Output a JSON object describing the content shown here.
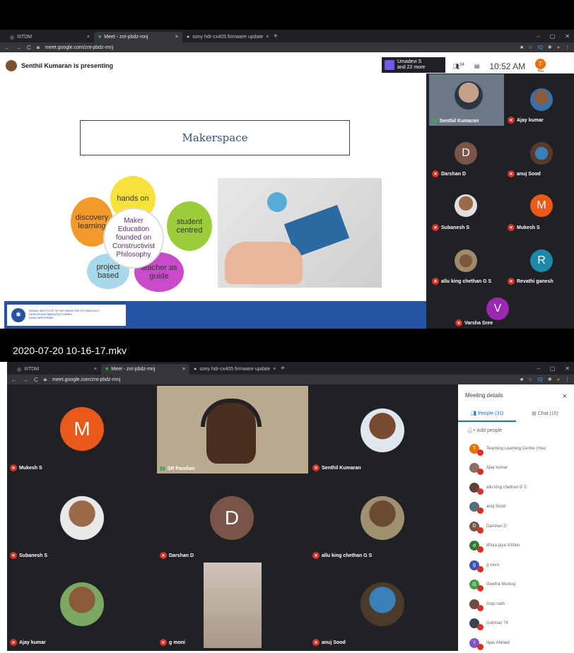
{
  "top": {
    "tabs": [
      {
        "label": "IIITDM"
      },
      {
        "label": "Meet - znt-pbdz-mnj",
        "active": true
      },
      {
        "label": "sony hdr-cx405 firmware update"
      }
    ],
    "url": "meet.google.com/znt-pbdz-mnj",
    "presenting": "Senthil Kumaran is presenting",
    "viewers": {
      "line1": "Umadevi S",
      "line2": "and 22 more"
    },
    "participants_count": "34",
    "time": "10:52 AM",
    "you_initial": "T",
    "you_label": "You",
    "slide": {
      "title": "Makerspace",
      "center_lines": [
        "Maker",
        "Education",
        "founded on",
        "Constructivist",
        "Philosophy"
      ],
      "petals": [
        "hands on",
        "student centred",
        "teacher as guide",
        "project based",
        "discovery learning"
      ],
      "institute_lines": [
        "INDIAN INSTITUTE OF INFORMATION TECHNOLOGY,",
        "DESIGN AND MANUFACTURING,",
        "KANCHEEPURAM"
      ]
    },
    "tiles": [
      {
        "name": "Senthil Kumaran",
        "kind": "video"
      },
      {
        "name": "Ajay kumar",
        "kind": "photo"
      },
      {
        "name": "Darshan D",
        "kind": "letter",
        "letter": "D",
        "color": "#795548"
      },
      {
        "name": "anuj Sood",
        "kind": "photo"
      },
      {
        "name": "Subanesh S",
        "kind": "photo"
      },
      {
        "name": "Mukesh S",
        "kind": "letter",
        "letter": "M",
        "color": "#e8591a"
      },
      {
        "name": "allu king chethan G S",
        "kind": "photo"
      },
      {
        "name": "Revathi ganesh",
        "kind": "letter",
        "letter": "R",
        "color": "#1e88a8"
      },
      {
        "name": "Varsha Sree",
        "kind": "letter",
        "letter": "V",
        "color": "#9c27b0"
      }
    ]
  },
  "caption": "2020-07-20 10-16-17.mkv",
  "bottom": {
    "url": "meet.google.com/znt-pbdz-mnj",
    "tiles": [
      {
        "name": "Mukesh S",
        "kind": "letter",
        "letter": "M",
        "color": "#e8591a"
      },
      {
        "name": "SR Pandian",
        "kind": "video"
      },
      {
        "name": "Senthil Kumaran",
        "kind": "photo"
      },
      {
        "name": "Subanesh S",
        "kind": "photo"
      },
      {
        "name": "Darshan D",
        "kind": "letter",
        "letter": "D",
        "color": "#795548"
      },
      {
        "name": "allu king chethan G S",
        "kind": "photo"
      },
      {
        "name": "Ajay kumar",
        "kind": "photo"
      },
      {
        "name": "g moni",
        "kind": "video"
      },
      {
        "name": "anuj Sood",
        "kind": "photo"
      }
    ],
    "panel": {
      "title": "Meeting details",
      "people_tab": "People (31)",
      "chat_tab": "Chat (10)",
      "add_people": "Add people",
      "people": [
        {
          "name": "Teaching Learning Centre (You)",
          "initial": "T",
          "color": "#e8710a"
        },
        {
          "name": "Ajay kumar",
          "initial": "",
          "color": "#8d6e63"
        },
        {
          "name": "allu king chethan G S",
          "initial": "",
          "color": "#5d4037"
        },
        {
          "name": "anuj Sood",
          "initial": "",
          "color": "#546e7a"
        },
        {
          "name": "Darshan D",
          "initial": "D",
          "color": "#795548"
        },
        {
          "name": "dhrya jaya Vishnu",
          "initial": "d",
          "color": "#2e7d32"
        },
        {
          "name": "g moni",
          "initial": "g",
          "color": "#3f51b5"
        },
        {
          "name": "Geetha Muniraj",
          "initial": "G",
          "color": "#43a047"
        },
        {
          "name": "Gopi nath",
          "initial": "",
          "color": "#6d4c41"
        },
        {
          "name": "Gulshan 74",
          "initial": "",
          "color": "#37474f"
        },
        {
          "name": "Ilyas Ahmed",
          "initial": "I",
          "color": "#7e57c2"
        }
      ]
    }
  }
}
